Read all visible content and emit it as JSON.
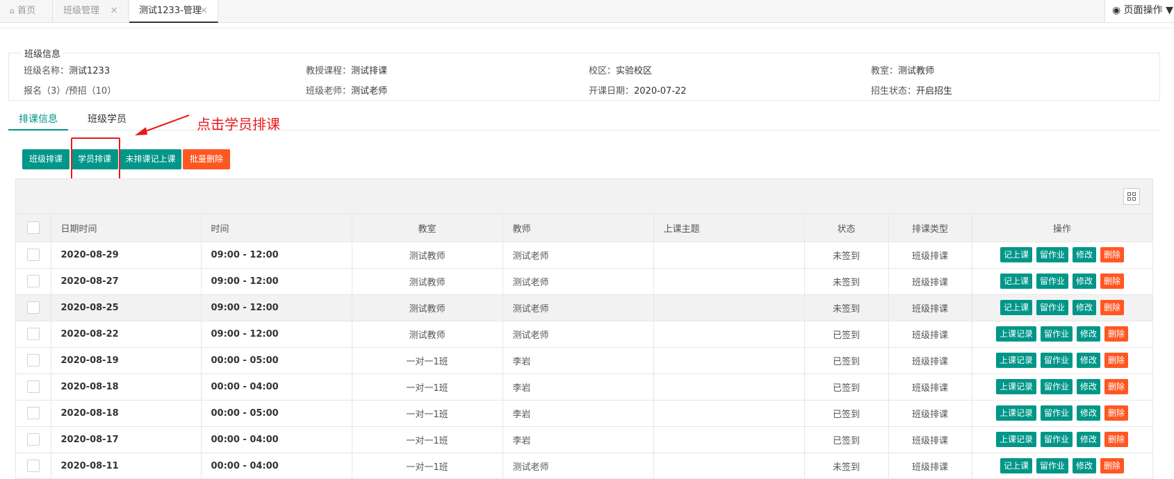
{
  "top_tabs": [
    {
      "label": "首页",
      "icon": "home-icon"
    },
    {
      "label": "班级管理",
      "closable": true
    },
    {
      "label": "测试1233-管理",
      "closable": true,
      "active": true
    }
  ],
  "page_ops": "页面操作",
  "class_info": {
    "legend": "班级信息",
    "rows": [
      [
        {
          "label": "班级名称：",
          "value": "测试1233"
        },
        {
          "label": "教授课程：",
          "value": "测试排课"
        },
        {
          "label": "校区：",
          "value": "实验校区"
        },
        {
          "label": "教室：",
          "value": "测试教师"
        }
      ],
      [
        {
          "label": "报名（3）/预招（10）",
          "value": ""
        },
        {
          "label": "班级老师：",
          "value": "测试老师"
        },
        {
          "label": "开课日期：",
          "value": "2020-07-22"
        },
        {
          "label": "招生状态：",
          "value": "开启招生"
        }
      ]
    ]
  },
  "section_tabs": [
    {
      "label": "排课信息",
      "active": true
    },
    {
      "label": "班级学员",
      "active": false
    }
  ],
  "annotation": "点击学员排课",
  "toolbar": {
    "class_schedule": "班级排课",
    "student_schedule": "学员排课",
    "unscheduled_record": "未排课记上课",
    "batch_delete": "批量删除"
  },
  "table": {
    "headers": [
      "日期时间",
      "时间",
      "教室",
      "教师",
      "上课主题",
      "状态",
      "排课类型",
      "操作"
    ],
    "rows": [
      {
        "date": "2020-08-29",
        "time": "09:00 - 12:00",
        "room": "测试教师",
        "teacher": "测试老师",
        "topic": "",
        "status": "未签到",
        "type": "班级排课",
        "actions": [
          "记上课",
          "留作业",
          "修改",
          "删除"
        ]
      },
      {
        "date": "2020-08-27",
        "time": "09:00 - 12:00",
        "room": "测试教师",
        "teacher": "测试老师",
        "topic": "",
        "status": "未签到",
        "type": "班级排课",
        "actions": [
          "记上课",
          "留作业",
          "修改",
          "删除"
        ]
      },
      {
        "date": "2020-08-25",
        "time": "09:00 - 12:00",
        "room": "测试教师",
        "teacher": "测试老师",
        "topic": "",
        "status": "未签到",
        "type": "班级排课",
        "actions": [
          "记上课",
          "留作业",
          "修改",
          "删除"
        ]
      },
      {
        "date": "2020-08-22",
        "time": "09:00 - 12:00",
        "room": "测试教师",
        "teacher": "测试老师",
        "topic": "",
        "status": "已签到",
        "type": "班级排课",
        "actions": [
          "上课记录",
          "留作业",
          "修改",
          "删除"
        ]
      },
      {
        "date": "2020-08-19",
        "time": "00:00 - 05:00",
        "room": "一对一1班",
        "teacher": "李岩",
        "topic": "",
        "status": "已签到",
        "type": "班级排课",
        "actions": [
          "上课记录",
          "留作业",
          "修改",
          "删除"
        ]
      },
      {
        "date": "2020-08-18",
        "time": "00:00 - 04:00",
        "room": "一对一1班",
        "teacher": "李岩",
        "topic": "",
        "status": "已签到",
        "type": "班级排课",
        "actions": [
          "上课记录",
          "留作业",
          "修改",
          "删除"
        ]
      },
      {
        "date": "2020-08-18",
        "time": "00:00 - 05:00",
        "room": "一对一1班",
        "teacher": "李岩",
        "topic": "",
        "status": "已签到",
        "type": "班级排课",
        "actions": [
          "上课记录",
          "留作业",
          "修改",
          "删除"
        ]
      },
      {
        "date": "2020-08-17",
        "time": "00:00 - 04:00",
        "room": "一对一1班",
        "teacher": "李岩",
        "topic": "",
        "status": "已签到",
        "type": "班级排课",
        "actions": [
          "上课记录",
          "留作业",
          "修改",
          "删除"
        ]
      },
      {
        "date": "2020-08-11",
        "time": "00:00 - 04:00",
        "room": "一对一1班",
        "teacher": "测试老师",
        "topic": "",
        "status": "未签到",
        "type": "班级排课",
        "actions": [
          "记上课",
          "留作业",
          "修改",
          "删除"
        ]
      }
    ]
  },
  "colors": {
    "teal": "#009688",
    "orange": "#ff5722",
    "annotation_red": "#e8191c"
  }
}
